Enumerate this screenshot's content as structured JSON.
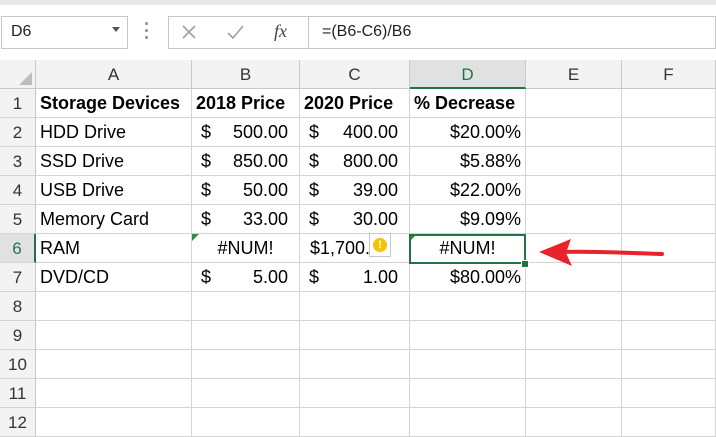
{
  "formula_bar": {
    "name_box": "D6",
    "cancel_icon": "close-icon",
    "enter_icon": "check-icon",
    "fx_label": "fx",
    "formula": "=(B6-C6)/B6"
  },
  "columns": [
    "A",
    "B",
    "C",
    "D",
    "E",
    "F"
  ],
  "rows": [
    "1",
    "2",
    "3",
    "4",
    "5",
    "6",
    "7",
    "8",
    "9",
    "10",
    "11",
    "12"
  ],
  "selected": {
    "column": "D",
    "row": "6",
    "cell": "D6"
  },
  "table": {
    "headers": [
      "Storage Devices",
      "2018 Price",
      "2020 Price",
      "% Decrease"
    ],
    "data": [
      {
        "device": "HDD Drive",
        "b_cur": "$",
        "b_num": "500.00",
        "c_cur": "$",
        "c_num": "400.00",
        "d": "$20.00%"
      },
      {
        "device": "SSD Drive",
        "b_cur": "$",
        "b_num": "850.00",
        "c_cur": "$",
        "c_num": "800.00",
        "d": "$5.88%"
      },
      {
        "device": "USB Drive",
        "b_cur": "$",
        "b_num": "50.00",
        "c_cur": "$",
        "c_num": "39.00",
        "d": "$22.00%"
      },
      {
        "device": "Memory Card",
        "b_cur": "$",
        "b_num": "33.00",
        "c_cur": "$",
        "c_num": "30.00",
        "d": "$9.09%"
      },
      {
        "device": "RAM",
        "b_text": "#NUM!",
        "c_text": "$1,700.00",
        "d_text": "#NUM!"
      },
      {
        "device": "DVD/CD",
        "b_cur": "$",
        "b_num": "5.00",
        "c_cur": "$",
        "c_num": "1.00",
        "d": "$80.00%"
      }
    ]
  },
  "annotation": {
    "arrow_color": "#e8232c",
    "points_to": "D6"
  },
  "colors": {
    "excel_green": "#217346",
    "error_flag": "#2e8b3d",
    "warning": "#f2c500"
  }
}
